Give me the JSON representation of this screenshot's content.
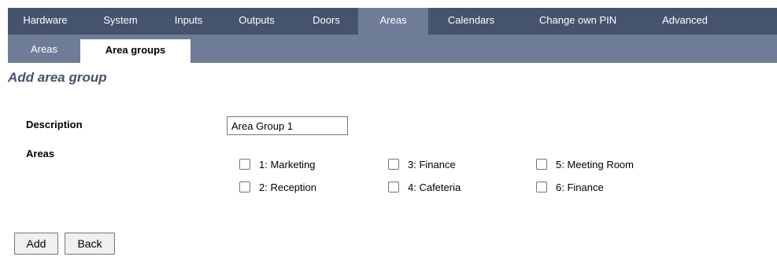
{
  "top_nav": {
    "tabs": [
      {
        "label": "Hardware"
      },
      {
        "label": "System"
      },
      {
        "label": "Inputs"
      },
      {
        "label": "Outputs"
      },
      {
        "label": "Doors"
      },
      {
        "label": "Areas"
      },
      {
        "label": "Calendars"
      },
      {
        "label": "Change own PIN"
      },
      {
        "label": "Advanced"
      }
    ],
    "active": "Areas"
  },
  "sub_nav": {
    "tabs": [
      {
        "label": "Areas"
      },
      {
        "label": "Area groups"
      }
    ],
    "active": "Area groups"
  },
  "page_title": "Add area group",
  "form": {
    "description_label": "Description",
    "description_value": "Area Group 1",
    "areas_label": "Areas",
    "areas": [
      {
        "label": "1: Marketing",
        "checked": false
      },
      {
        "label": "2: Reception",
        "checked": false
      },
      {
        "label": "3: Finance",
        "checked": false
      },
      {
        "label": "4: Cafeteria",
        "checked": false
      },
      {
        "label": "5: Meeting Room",
        "checked": false
      },
      {
        "label": "6: Finance",
        "checked": false
      }
    ]
  },
  "buttons": {
    "add_label": "Add",
    "back_label": "Back"
  },
  "colors": {
    "nav_dark": "#46536d",
    "nav_light": "#6f7c98",
    "title": "#46536d"
  }
}
